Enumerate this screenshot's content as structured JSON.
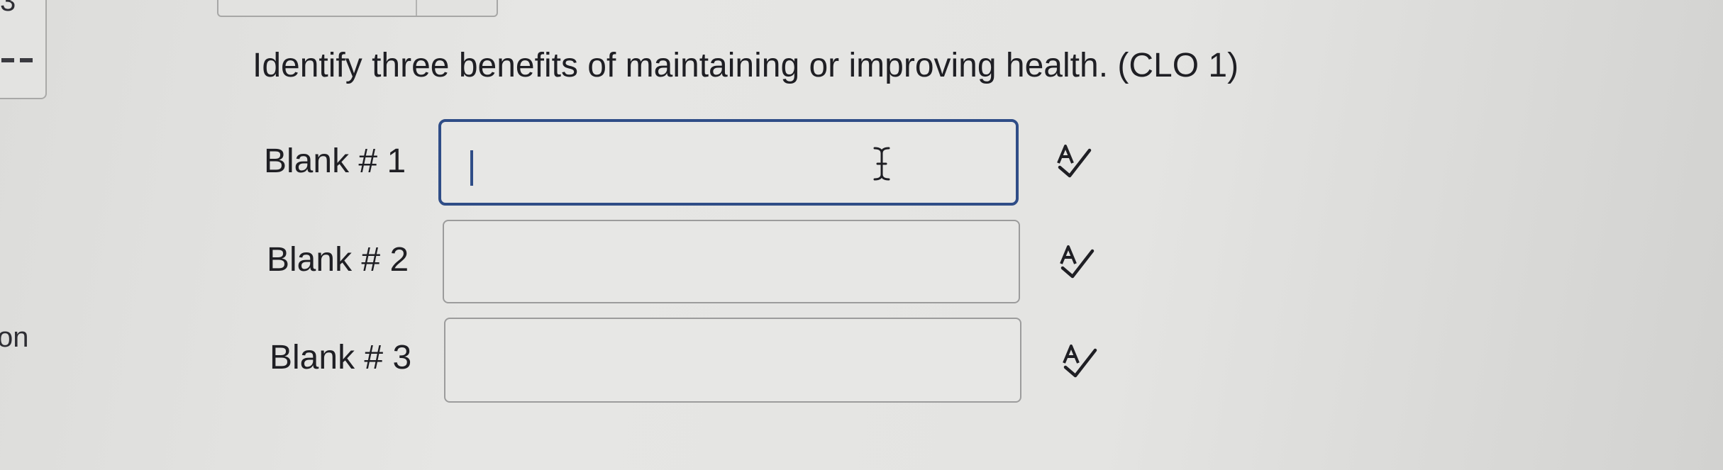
{
  "sidebar": {
    "question_number": "3",
    "partial_label": "on"
  },
  "question": {
    "text": "Identify three benefits of maintaining or improving health. (CLO 1)"
  },
  "blanks": [
    {
      "label": "Blank # 1",
      "value": "",
      "focused": true
    },
    {
      "label": "Blank # 2",
      "value": "",
      "focused": false
    },
    {
      "label": "Blank # 3",
      "value": "",
      "focused": false
    }
  ],
  "icons": {
    "spellcheck": "spellcheck-icon",
    "text_cursor": "ibeam-cursor-icon"
  },
  "colors": {
    "focus_border": "#2f4d87",
    "input_border": "#9c9c9c",
    "text": "#1f1f24"
  }
}
